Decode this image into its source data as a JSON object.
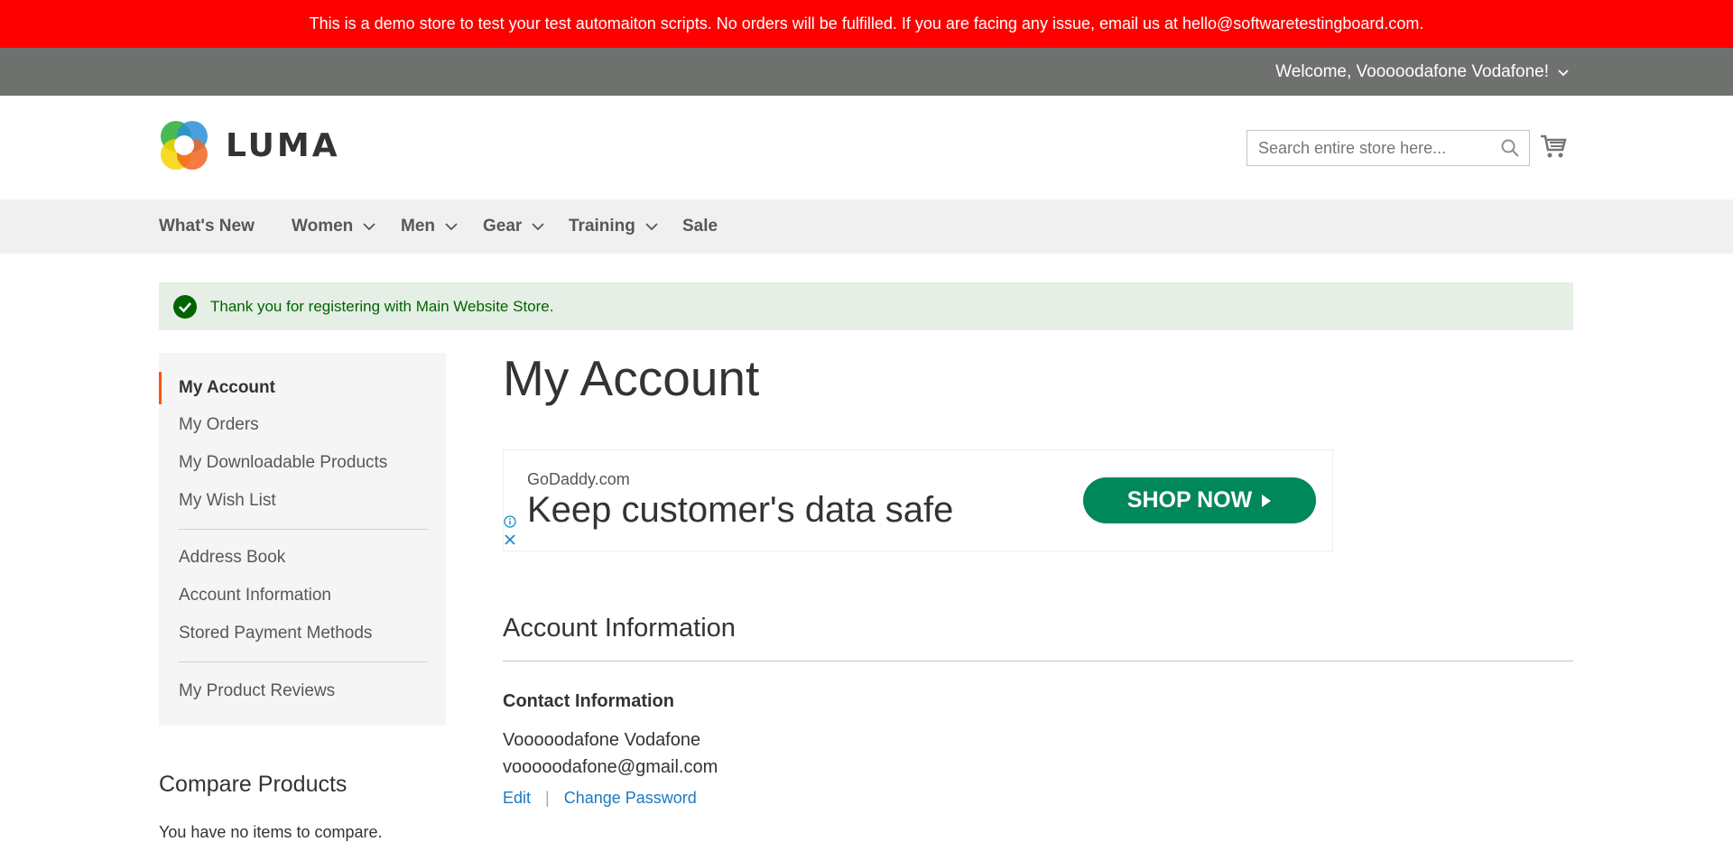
{
  "demo_notice": "This is a demo store to test your test automaiton scripts. No orders will be fulfilled. If you are facing any issue, email us at hello@softwaretestingboard.com.",
  "header_panel": {
    "welcome": "Welcome, Vooooodafone Vodafone!"
  },
  "logo": {
    "text": "LUMA"
  },
  "search": {
    "placeholder": "Search entire store here..."
  },
  "nav": {
    "items": [
      {
        "label": "What's New"
      },
      {
        "label": "Women"
      },
      {
        "label": "Men"
      },
      {
        "label": "Gear"
      },
      {
        "label": "Training"
      },
      {
        "label": "Sale"
      }
    ]
  },
  "message": {
    "text": "Thank you for registering with Main Website Store."
  },
  "sidebar": {
    "items": [
      {
        "label": "My Account"
      },
      {
        "label": "My Orders"
      },
      {
        "label": "My Downloadable Products"
      },
      {
        "label": "My Wish List"
      },
      {
        "label": "Address Book"
      },
      {
        "label": "Account Information"
      },
      {
        "label": "Stored Payment Methods"
      },
      {
        "label": "My Product Reviews"
      }
    ]
  },
  "compare": {
    "title": "Compare Products",
    "empty": "You have no items to compare."
  },
  "main": {
    "title": "My Account",
    "ad": {
      "domain": "GoDaddy.com",
      "headline": "Keep customer's data safe",
      "button": "SHOP NOW"
    },
    "account_info": {
      "title": "Account Information",
      "contact_title": "Contact Information",
      "name": "Vooooodafone Vodafone",
      "email": "vooooodafone@gmail.com",
      "edit": "Edit",
      "separator": "|",
      "change_password": "Change Password"
    }
  },
  "colors": {
    "demo_bar": "#ff0000",
    "panel": "#6e716e",
    "accent": "#ff5501",
    "link": "#1979c3",
    "success": "#006400",
    "ad_button": "#00875a"
  }
}
